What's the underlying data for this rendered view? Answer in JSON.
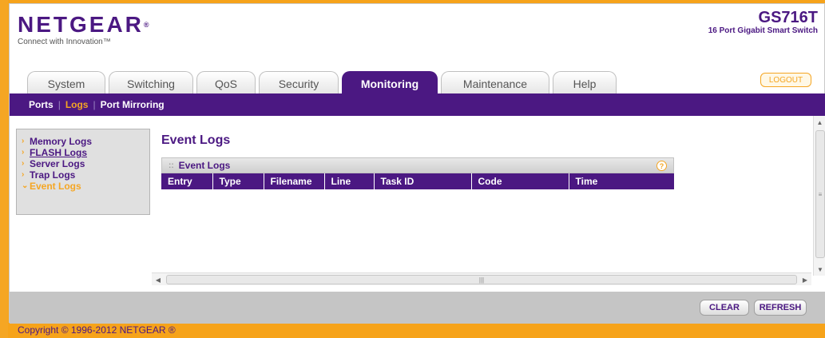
{
  "header": {
    "brand": "NETGEAR",
    "brand_mark": "®",
    "tagline": "Connect with Innovation™",
    "model": "GS716T",
    "model_desc": "16 Port Gigabit Smart Switch"
  },
  "tabs": [
    {
      "label": "System"
    },
    {
      "label": "Switching"
    },
    {
      "label": "QoS"
    },
    {
      "label": "Security"
    },
    {
      "label": "Monitoring"
    },
    {
      "label": "Maintenance"
    },
    {
      "label": "Help"
    }
  ],
  "active_tab": "Monitoring",
  "logout_label": "LOGOUT",
  "subnav": {
    "items": [
      {
        "label": "Ports"
      },
      {
        "label": "Logs"
      },
      {
        "label": "Port Mirroring"
      }
    ],
    "separator": "|"
  },
  "left_nav": {
    "items": [
      {
        "label": "Memory Logs",
        "marker": "›"
      },
      {
        "label": "FLASH Logs",
        "marker": "›"
      },
      {
        "label": "Server Logs",
        "marker": "›"
      },
      {
        "label": "Trap Logs",
        "marker": "›"
      },
      {
        "label": "Event Logs",
        "marker": "⌄"
      }
    ]
  },
  "main": {
    "title": "Event Logs",
    "section_title": "Event Logs",
    "help_glyph": "?",
    "columns": [
      "Entry",
      "Type",
      "Filename",
      "Line",
      "Task ID",
      "Code",
      "Time"
    ]
  },
  "buttons": {
    "clear": "CLEAR",
    "refresh": "REFRESH"
  },
  "footer": {
    "copyright": "Copyright © 1996-2012 NETGEAR ®"
  },
  "colors": {
    "brand_purple": "#4b1882",
    "accent_orange": "#f5a623"
  }
}
